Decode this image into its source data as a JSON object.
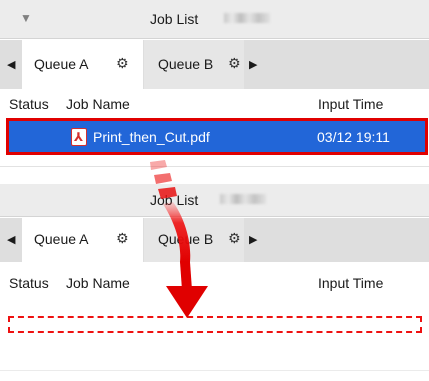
{
  "panels": [
    {
      "title": "Job List",
      "tabs": [
        {
          "label": "Queue A",
          "active": true,
          "gear_icon": "gear-icon"
        },
        {
          "label": "Queue B",
          "active": false,
          "gear_icon": "gear-icon"
        }
      ],
      "columns": {
        "status": "Status",
        "job_name": "Job Name",
        "input_time": "Input Time"
      },
      "rows": [
        {
          "file_icon": "pdf-icon",
          "name": "Print_then_Cut.pdf",
          "input_time": "03/12 19:11",
          "selected": true
        }
      ]
    },
    {
      "title": "Job List",
      "tabs": [
        {
          "label": "Queue A",
          "active": true,
          "gear_icon": "gear-icon"
        },
        {
          "label": "Queue B",
          "active": false,
          "gear_icon": "gear-icon"
        }
      ],
      "columns": {
        "status": "Status",
        "job_name": "Job Name",
        "input_time": "Input Time"
      },
      "rows": []
    }
  ],
  "icons": {
    "collapse": "triangle-down-icon",
    "scroll_left": "arrow-left-icon",
    "scroll_right": "arrow-right-icon",
    "drag_arrow": "down-arrow-icon"
  },
  "colors": {
    "selection": "#2266d8",
    "highlight_border": "#e00000",
    "drag_arrow": "#e00000",
    "tab_bar": "#dedede",
    "title_bar": "#ececec"
  }
}
